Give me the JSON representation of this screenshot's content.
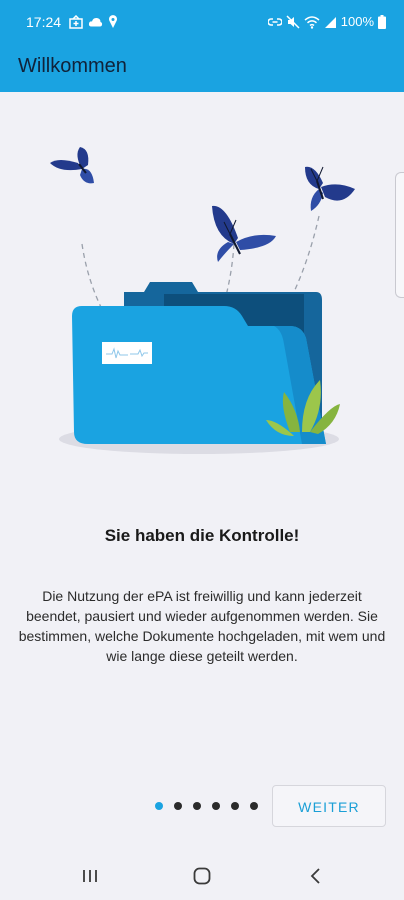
{
  "status_bar": {
    "time": "17:24",
    "battery": "100%",
    "left_icons": [
      "hospital-icon",
      "cloud-icon",
      "location-pin-icon"
    ],
    "right_icons": [
      "link-icon",
      "mute-icon",
      "wifi-icon",
      "signal-icon",
      "battery-icon"
    ]
  },
  "app_bar": {
    "title": "Willkommen",
    "background": "#1aa3e1"
  },
  "onboarding": {
    "illustration": "folder-with-butterflies-illustration",
    "headline": "Sie haben die Kontrolle!",
    "description": "Die Nutzung der ePA ist freiwillig und kann jederzeit beendet, pausiert und wieder aufgenommen werden. Sie bestimmen, welche Dokumente hochgeladen, mit wem und wie lange diese geteilt werden.",
    "pager": {
      "total": 6,
      "active_index": 0
    },
    "next_label": "WEITER"
  },
  "nav_bar": {
    "icons": [
      "recent-apps-icon",
      "home-icon",
      "back-icon"
    ]
  },
  "colors": {
    "accent": "#1aa3e1",
    "background": "#f1f1f6"
  }
}
